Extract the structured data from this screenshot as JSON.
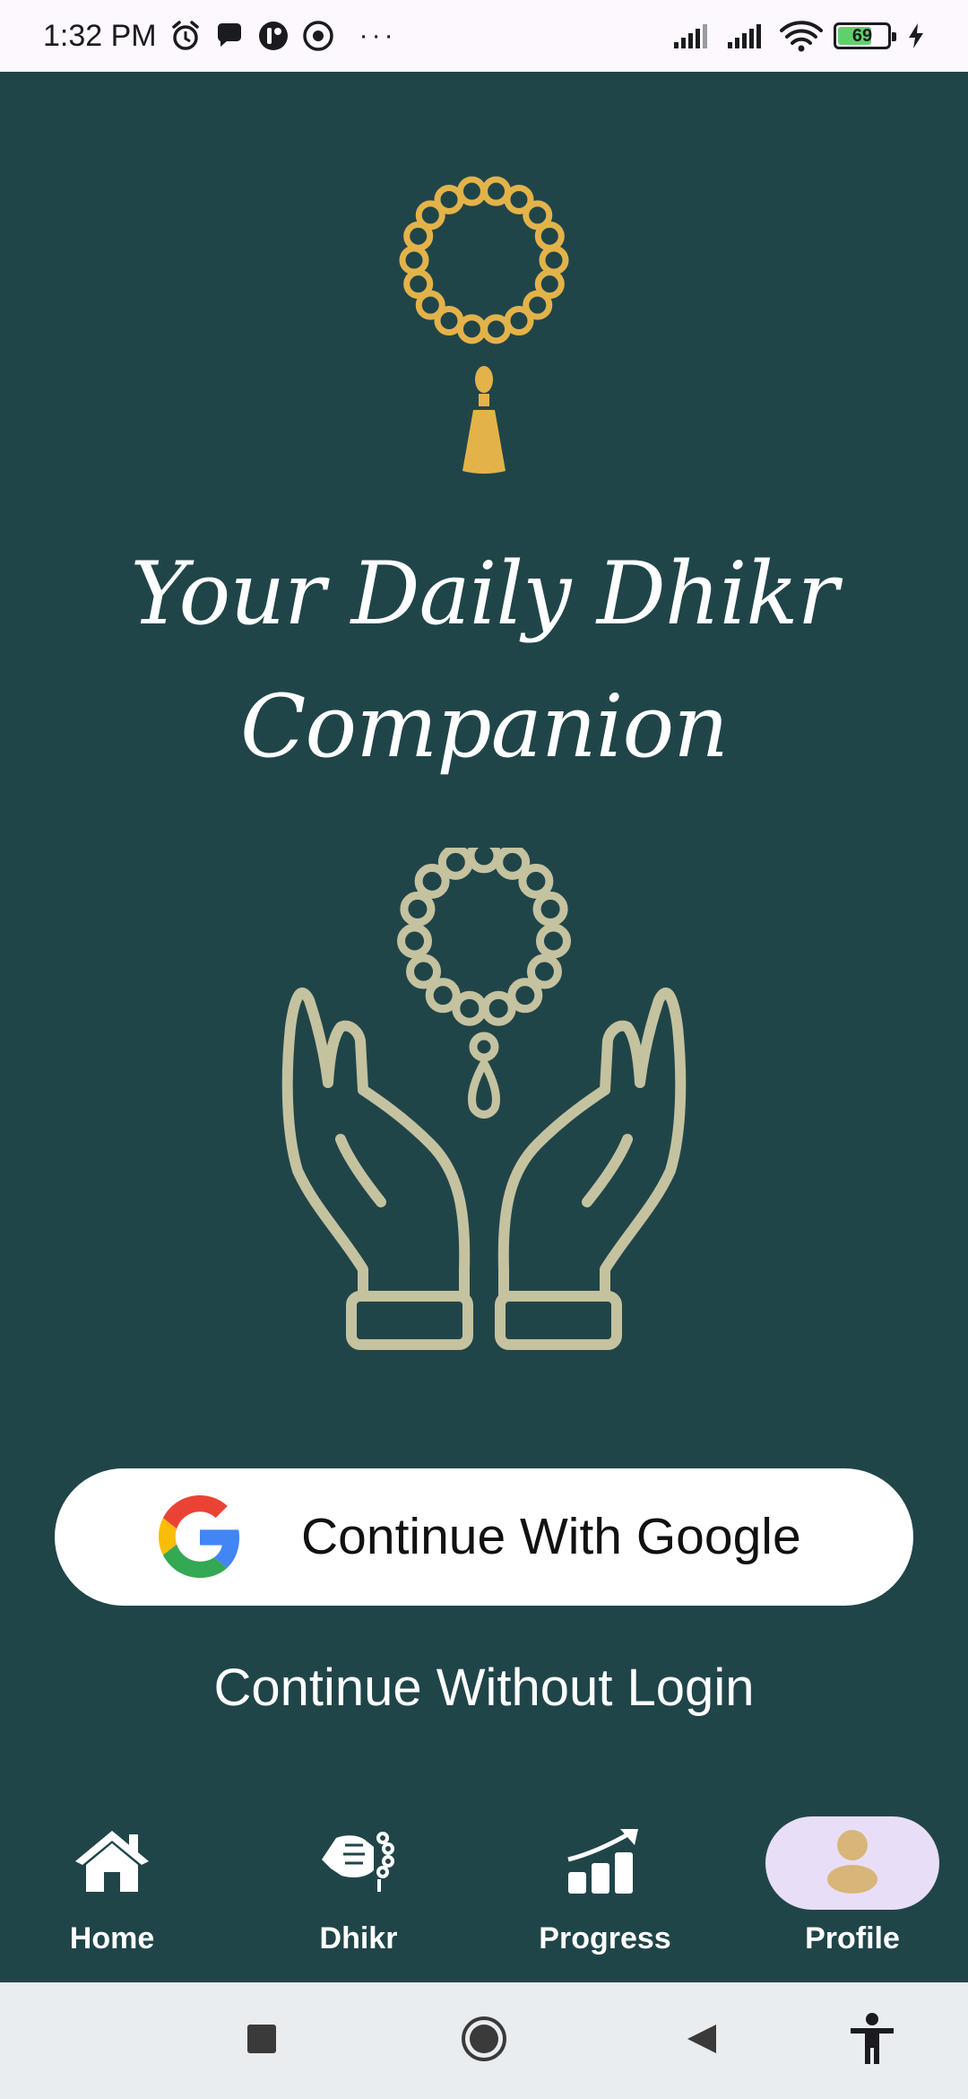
{
  "status_bar": {
    "time": "1:32 PM",
    "overflow": "···",
    "battery_level": "69",
    "battery_fraction": 0.69,
    "icons": [
      "alarm-icon",
      "chat-bubble-icon",
      "app-notification-icon",
      "target-icon",
      "signal-icon",
      "signal-icon",
      "wifi-icon",
      "battery-icon",
      "charging-bolt-icon"
    ]
  },
  "main": {
    "title_line1": "Your Daily Dhikr",
    "title_line2": "Companion",
    "google_button_label": "Continue With Google",
    "guest_link_label": "Continue Without Login"
  },
  "bottom_nav": {
    "items": [
      {
        "label": "Home",
        "icon": "home-icon"
      },
      {
        "label": "Dhikr",
        "icon": "prayer-beads-hand-icon"
      },
      {
        "label": "Progress",
        "icon": "progress-chart-icon"
      },
      {
        "label": "Profile",
        "icon": "person-icon",
        "active": true
      }
    ]
  },
  "colors": {
    "background": "#204549",
    "gold": "#e3b34a",
    "beads_sage": "#c5c2a0",
    "nav_active_pill": "#e8def8",
    "profile_icon": "#d8b67a"
  }
}
